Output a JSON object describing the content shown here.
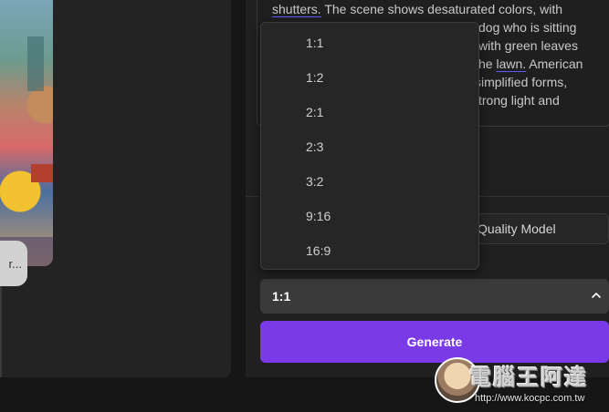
{
  "prompt": {
    "lines": [
      [
        "shutters.",
        " The scene shows desaturated colors, with"
      ],
      [
        "",
        "dog who is sitting"
      ],
      [
        "",
        "with green leaves"
      ],
      [
        "",
        "he ",
        "lawn.",
        " American"
      ],
      [
        "",
        "simplified forms,"
      ],
      [
        "",
        "trong light and"
      ]
    ]
  },
  "left": {
    "chip_text": "r..."
  },
  "model": {
    "label": "Quality Model"
  },
  "aspect_ratio": {
    "selected": "1:1",
    "options": [
      "1:1",
      "1:2",
      "2:1",
      "2:3",
      "3:2",
      "9:16",
      "16:9"
    ]
  },
  "generate_label": "Generate",
  "watermark": {
    "title": "電腦王阿達",
    "url": "http://www.kocpc.com.tw"
  },
  "colors": {
    "accent": "#7b3ae8",
    "panel": "#202020",
    "dropdown": "#262626"
  },
  "icons": {
    "ratio_select": "chevron-up-icon"
  }
}
